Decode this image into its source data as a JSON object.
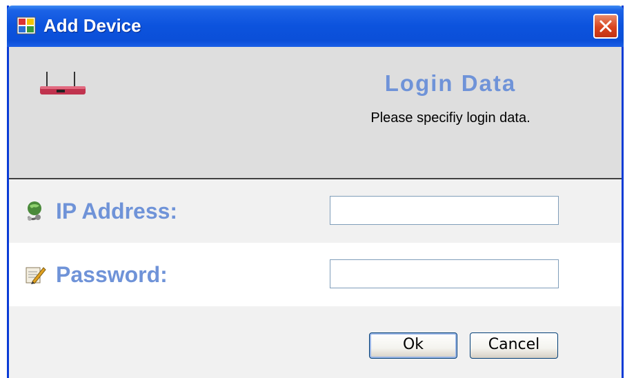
{
  "window": {
    "title": "Add Device",
    "app_icon": "window-app-icon",
    "close_icon": "close-icon"
  },
  "header": {
    "device_icon": "router-icon",
    "title": "Login Data",
    "subtitle": "Please specifiy login data."
  },
  "form": {
    "ip": {
      "icon": "network-globe-icon",
      "label": "IP Address:",
      "value": "",
      "placeholder": ""
    },
    "password": {
      "icon": "edit-pencil-icon",
      "label": "Password:",
      "value": "",
      "placeholder": ""
    }
  },
  "buttons": {
    "ok_label": "Ok",
    "cancel_label": "Cancel"
  },
  "colors": {
    "titlebar": "#0c53dd",
    "accent_label": "#6f93d8",
    "header_bg": "#dedede",
    "router": "#c0334e"
  }
}
